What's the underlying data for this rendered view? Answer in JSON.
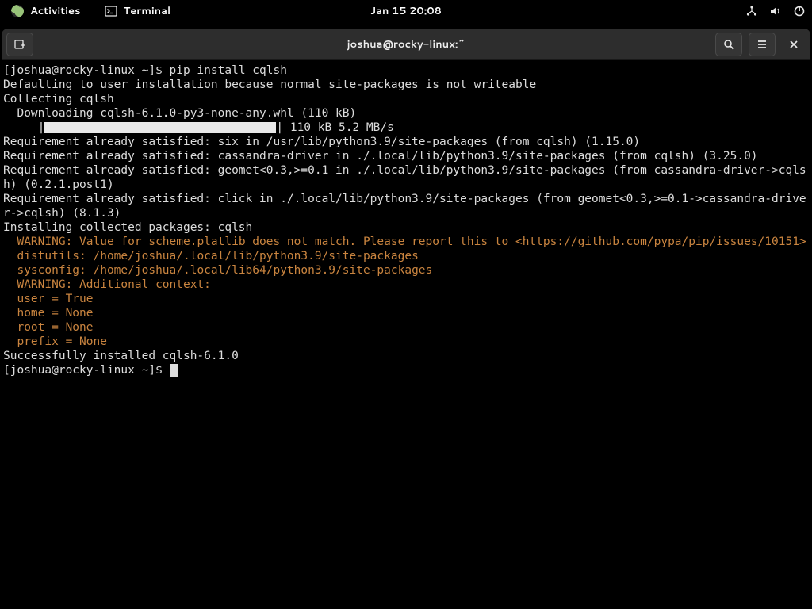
{
  "topbar": {
    "activities": "Activities",
    "terminal_label": "Terminal",
    "clock": "Jan 15  20:08"
  },
  "window": {
    "title": "joshua@rocky-linux:~"
  },
  "terminal": {
    "prompt1": "[joshua@rocky-linux ~]$ ",
    "cmd1": "pip install cqlsh",
    "lines": [
      "Defaulting to user installation because normal site-packages is not writeable",
      "Collecting cqlsh",
      "  Downloading cqlsh-6.1.0-py3-none-any.whl (110 kB)"
    ],
    "progress_prefix": "     |",
    "progress_suffix": "| 110 kB 5.2 MB/s",
    "req_lines": [
      "Requirement already satisfied: six in /usr/lib/python3.9/site-packages (from cqlsh) (1.15.0)",
      "Requirement already satisfied: cassandra-driver in ./.local/lib/python3.9/site-packages (from cqlsh) (3.25.0)",
      "Requirement already satisfied: geomet<0.3,>=0.1 in ./.local/lib/python3.9/site-packages (from cassandra-driver->cqlsh) (0.2.1.post1)",
      "Requirement already satisfied: click in ./.local/lib/python3.9/site-packages (from geomet<0.3,>=0.1->cassandra-driver->cqlsh) (8.1.3)",
      "Installing collected packages: cqlsh"
    ],
    "warn_lines": [
      "  WARNING: Value for scheme.platlib does not match. Please report this to <https://github.com/pypa/pip/issues/10151>",
      "  distutils: /home/joshua/.local/lib/python3.9/site-packages",
      "  sysconfig: /home/joshua/.local/lib64/python3.9/site-packages",
      "  WARNING: Additional context:",
      "  user = True",
      "  home = None",
      "  root = None",
      "  prefix = None"
    ],
    "success": "Successfully installed cqlsh-6.1.0",
    "prompt2": "[joshua@rocky-linux ~]$ "
  }
}
